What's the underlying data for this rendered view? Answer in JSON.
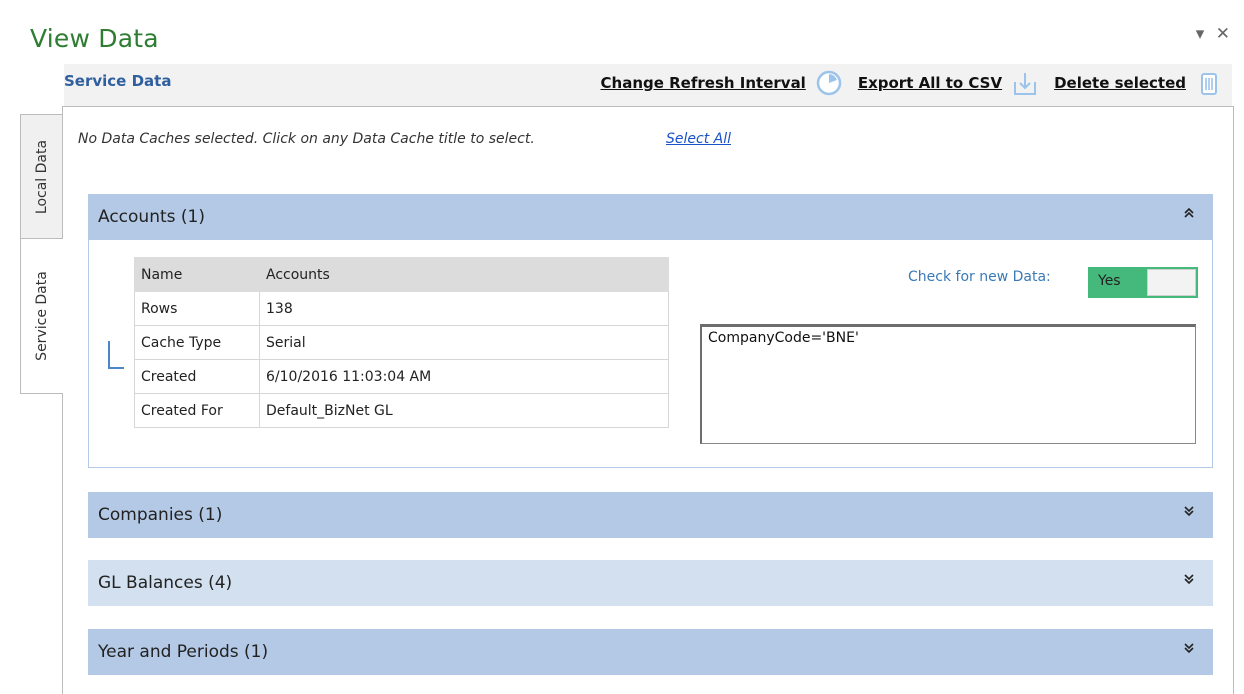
{
  "pane": {
    "title": "View Data",
    "controls": {
      "dropdown": "▾",
      "close": "✕"
    }
  },
  "toolbar": {
    "title": "Service Data",
    "change_refresh_label": "Change Refresh Interval",
    "export_label": "Export All to CSV",
    "delete_label": "Delete selected",
    "icons": [
      "clock-icon",
      "download-icon",
      "trash-icon"
    ]
  },
  "side_tabs": {
    "local": "Local Data",
    "service": "Service Data"
  },
  "info": {
    "message": "No Data Caches selected. Click on any Data Cache title to select.",
    "select_all": "Select All"
  },
  "sections": [
    {
      "title": "Accounts (1)",
      "expanded": true,
      "chevron": "⌃"
    },
    {
      "title": "Companies (1)",
      "expanded": false,
      "chevron": "⌄"
    },
    {
      "title": "GL Balances (4)",
      "expanded": false,
      "chevron": "⌄"
    },
    {
      "title": "Year and Periods (1)",
      "expanded": false,
      "chevron": "⌄"
    }
  ],
  "accounts_details": {
    "rows": [
      {
        "key": "Name",
        "value": "Accounts"
      },
      {
        "key": "Rows",
        "value": "138"
      },
      {
        "key": "Cache Type",
        "value": "Serial"
      },
      {
        "key": "Created",
        "value": "6/10/2016 11:03:04 AM"
      },
      {
        "key": "Created For",
        "value": "Default_BizNet GL"
      }
    ],
    "check_label": "Check for new Data:",
    "toggle_value": "Yes",
    "filter": "CompanyCode='BNE'"
  },
  "colors": {
    "accent_green": "#2e7d32",
    "header_blue": "#b4c9e5",
    "header_light": "#d2e0f0",
    "toggle_on": "#45b97c",
    "link_blue": "#1a52c9"
  }
}
